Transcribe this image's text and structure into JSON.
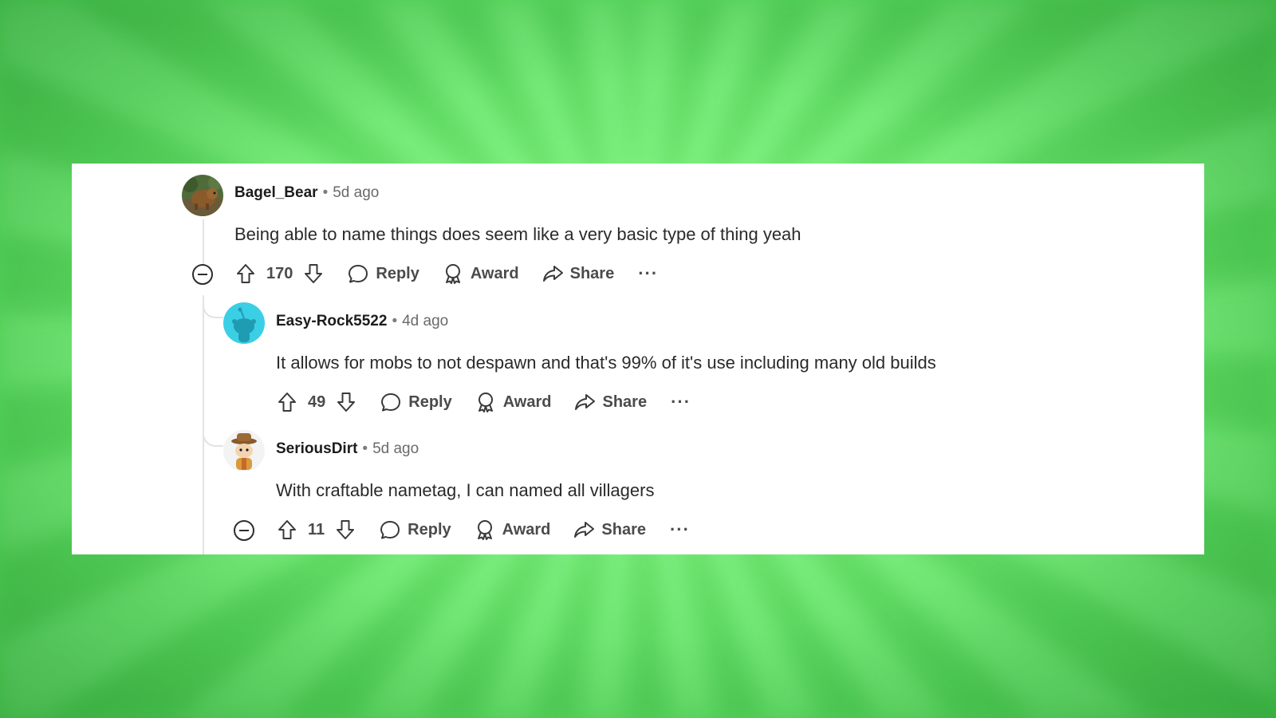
{
  "comments": [
    {
      "username": "Bagel_Bear",
      "time": "5d ago",
      "body": "Being able to name things does seem like a very basic type of thing yeah",
      "score": "170",
      "reply_label": "Reply",
      "award_label": "Award",
      "share_label": "Share",
      "more_label": "···"
    },
    {
      "username": "Easy-Rock5522",
      "time": "4d ago",
      "body": "It allows for mobs to not despawn and that's 99% of it's use including many old builds",
      "score": "49",
      "reply_label": "Reply",
      "award_label": "Award",
      "share_label": "Share",
      "more_label": "···"
    },
    {
      "username": "SeriousDirt",
      "time": "5d ago",
      "body": "With craftable nametag, I can named all villagers",
      "score": "11",
      "reply_label": "Reply",
      "award_label": "Award",
      "share_label": "Share",
      "more_label": "···"
    }
  ],
  "separator": "•",
  "colors": {
    "background_green": "#72f173",
    "card": "#ffffff",
    "text": "#2a2a2a",
    "muted": "#6a6a6a",
    "avatar_snoo": "#3bcfe6"
  }
}
